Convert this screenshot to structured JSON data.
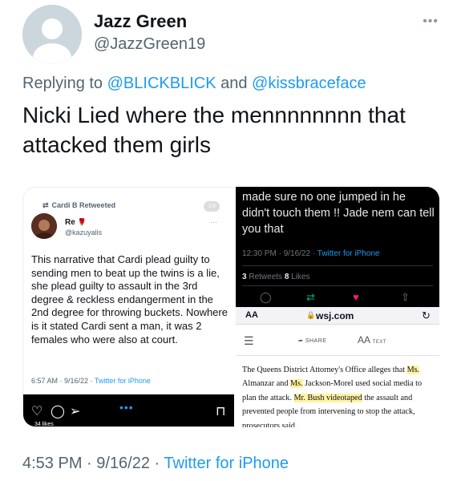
{
  "author": {
    "name": "Jazz Green",
    "handle": "@JazzGreen19",
    "more_icon": "more-horizontal-icon"
  },
  "reply": {
    "prefix": "Replying to ",
    "mention1": "@BLICKBLICK",
    "joiner": " and ",
    "mention2": "@kissbraceface"
  },
  "tweet": {
    "text": "Nicki Lied where the mennnnnnnn that attacked them girls",
    "time": "4:53 PM · 9/16/22 · ",
    "source": "Twitter for iPhone"
  },
  "colors": {
    "accent": "#1d9bf0",
    "text": "#0f1419",
    "secondary": "#536471",
    "dark_bg": "#000000",
    "highlight": "#fff3a3"
  },
  "media": {
    "left": {
      "retweet_label": "Cardi B Retweeted",
      "page_indicator": "1/3",
      "user_name": "Re",
      "user_emoji": "🌹",
      "user_handle": "@kazuyalis",
      "more": "···",
      "body": "This narrative that Cardi plead guilty to sending men to beat up the twins is a lie, she plead guilty to assault in the 3rd degree & reckless endangerment in the 2nd degree for throwing buckets. Nowhere is it stated Cardi sent a man, it was 2 females who were also at court.",
      "meta_time": "6:57 AM · 9/16/22 · ",
      "meta_source": "Twitter for iPhone",
      "footer_text": "34 likes"
    },
    "right_top": {
      "body": "made sure no one jumped in he didn't touch them !! Jade nem can tell you that",
      "meta_time": "12:30 PM · 9/16/22 · ",
      "meta_source": "Twitter for iPhone",
      "retweets_count": "3",
      "retweets_label": "Retweets",
      "likes_count": "8",
      "likes_label": "Likes"
    },
    "right_bottom": {
      "aa": "AA",
      "url": "wsj.com",
      "share_label": "SHARE",
      "text_label_big": "AA",
      "text_label_small": "TEXT",
      "article_parts": [
        "The Queens District Attorney's Office alleges that ",
        "Ms.",
        " Almanzar and ",
        "Ms.",
        " Jackson-Morel used social media to plan the attack. ",
        "Mr. Bush videotaped",
        " the assault and prevented people from intervening to stop the attack, prosecutors said."
      ]
    }
  }
}
